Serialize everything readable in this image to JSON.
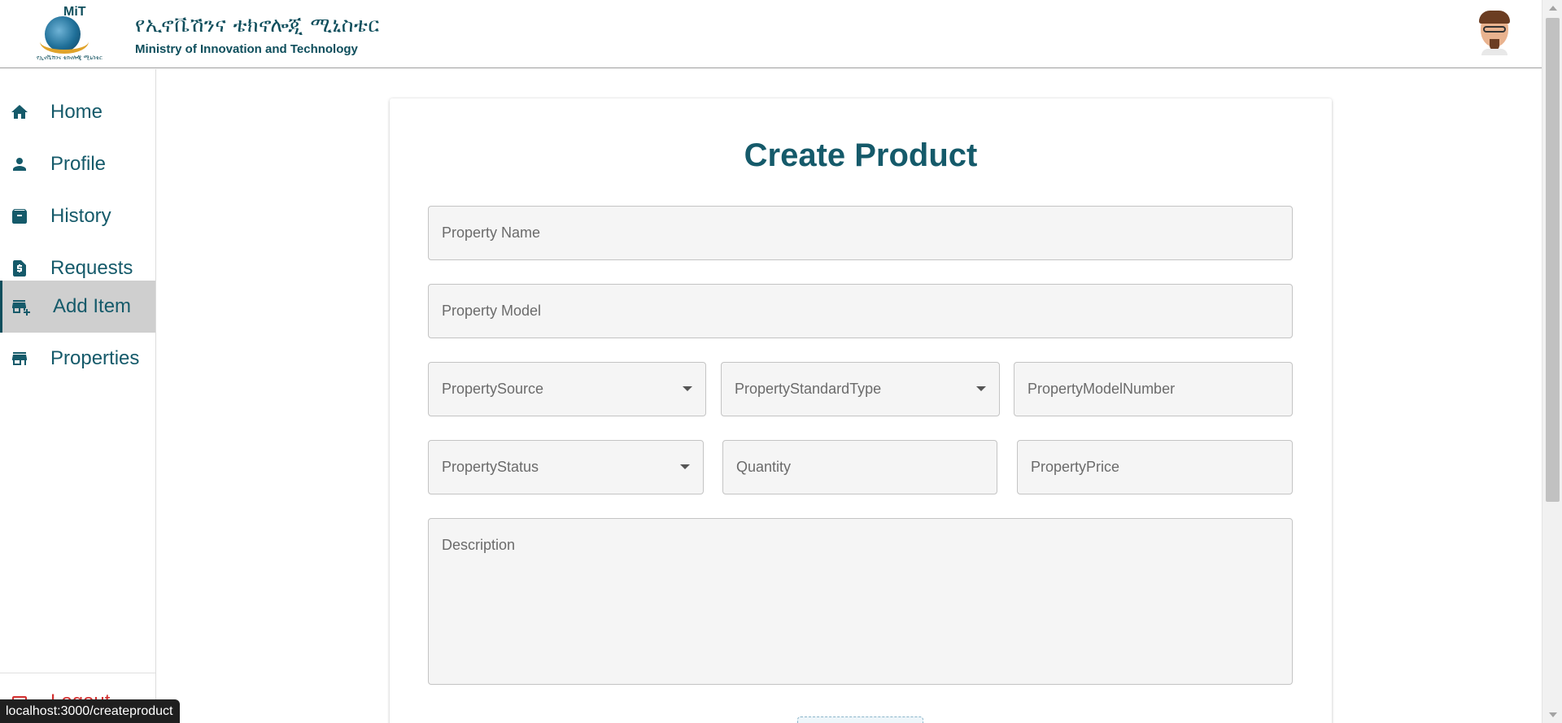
{
  "header": {
    "logo_text": "MiT",
    "logo_subtext": "የኢኖቬሽንና ቴክኖሎጂ ሚኒስቴር",
    "org_name_amharic": "የኢኖቬሽንና ቴክኖሎጂ ሚኒስቴር",
    "org_name_english": "Ministry of Innovation and Technology"
  },
  "sidebar": {
    "items": [
      {
        "label": "Home",
        "icon": "home-icon"
      },
      {
        "label": "Profile",
        "icon": "person-icon"
      },
      {
        "label": "History",
        "icon": "archive-icon"
      },
      {
        "label": "Requests",
        "icon": "document-dollar-icon"
      },
      {
        "label": "Add Item",
        "icon": "add-business-icon",
        "active": true
      },
      {
        "label": "Properties",
        "icon": "store-icon"
      }
    ],
    "logout_label": "Logout"
  },
  "form": {
    "title": "Create Product",
    "property_name_placeholder": "Property Name",
    "property_model_placeholder": "Property Model",
    "property_source_placeholder": "PropertySource",
    "property_standard_type_placeholder": "PropertyStandardType",
    "property_model_number_placeholder": "PropertyModelNumber",
    "property_status_placeholder": "PropertyStatus",
    "quantity_placeholder": "Quantity",
    "property_price_placeholder": "PropertyPrice",
    "description_placeholder": "Description"
  },
  "status_bar": {
    "url": "localhost:3000/createproduct"
  },
  "colors": {
    "accent": "#155a6a",
    "active_nav_bg": "#cfcfcf",
    "logout": "#d32f2f",
    "field_bg": "#f5f5f5"
  }
}
